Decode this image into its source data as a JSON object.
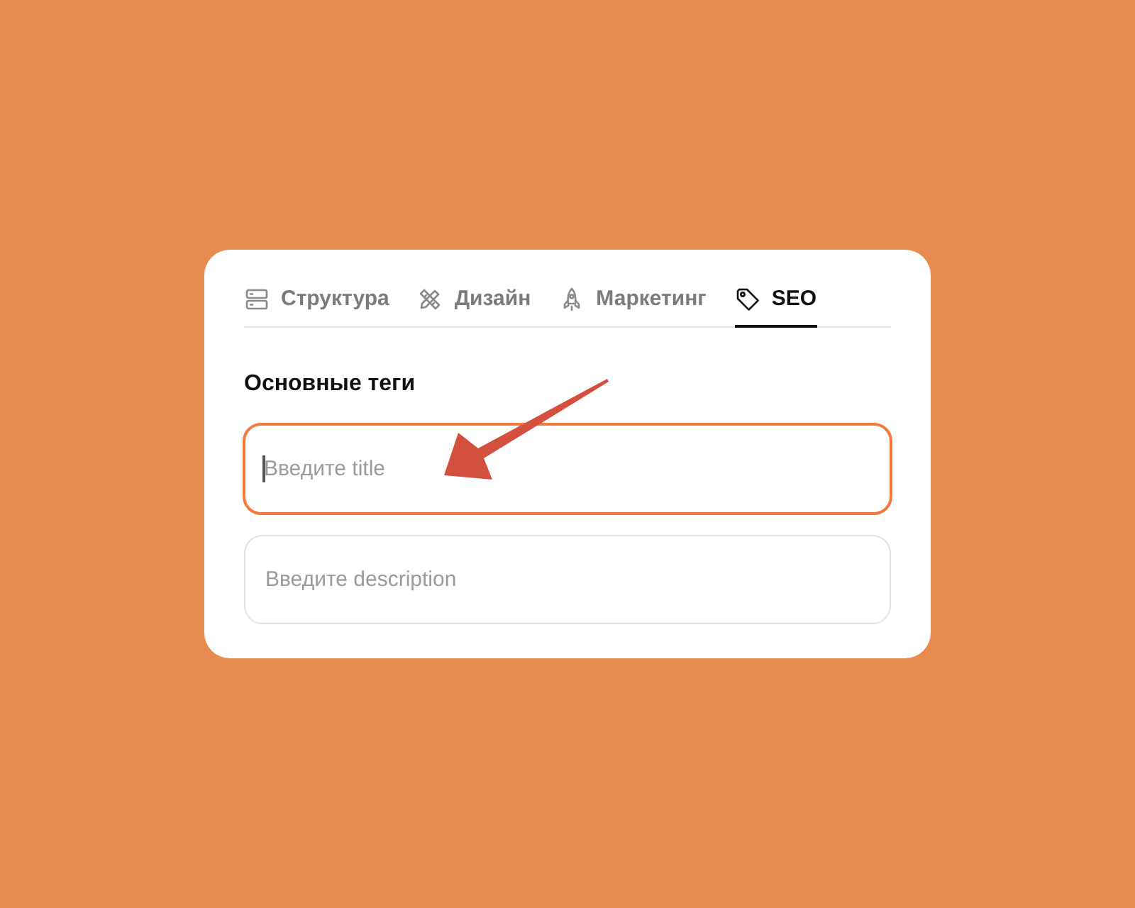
{
  "tabs": [
    {
      "label": "Структура",
      "selected": false
    },
    {
      "label": "Дизайн",
      "selected": false
    },
    {
      "label": "Маркетинг",
      "selected": false
    },
    {
      "label": "SEO",
      "selected": true
    }
  ],
  "section": {
    "heading": "Основные теги",
    "fields": [
      {
        "placeholder": "Введите title",
        "focused": true
      },
      {
        "placeholder": "Введите description",
        "focused": false
      }
    ]
  }
}
